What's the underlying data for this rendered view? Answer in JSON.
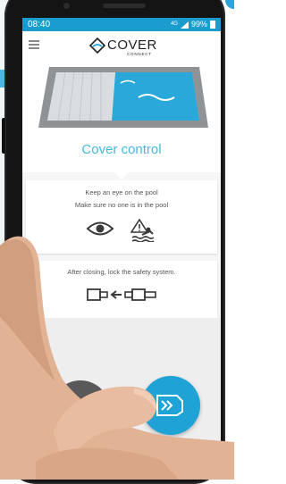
{
  "status": {
    "time": "08:40",
    "network": "4G",
    "battery": "99%"
  },
  "app": {
    "logo_main": "COVER",
    "logo_sub": "CONNECT"
  },
  "page": {
    "title": "Cover control"
  },
  "card_eye": {
    "line1": "Keep an eye on the pool",
    "line2": "Make sure no one is in the pool"
  },
  "card_lock": {
    "line1": "After closing, lock the safety system."
  },
  "actions": {
    "close_label": "Close"
  },
  "colors": {
    "brand": "#1a9ccf",
    "accent": "#45b9de",
    "open_button": "#595959",
    "close_button": "#1fa3d6"
  },
  "icons": [
    "menu-icon",
    "eye-icon",
    "pool-warning-icon",
    "safety-lock-icon",
    "close-cover-icon",
    "open-cover-icon"
  ]
}
